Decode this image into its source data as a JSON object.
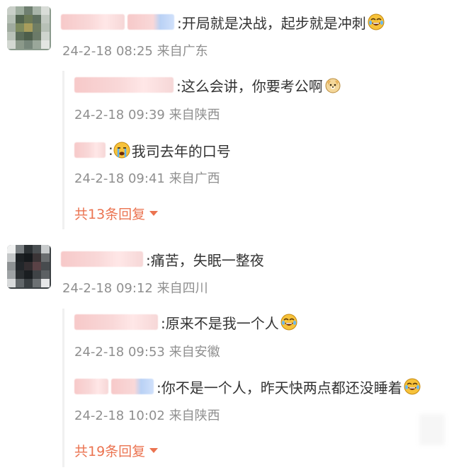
{
  "comments": [
    {
      "text": ":开局就是决战，起步就是冲刺",
      "emoji": "laughing-tears-emoji",
      "meta": "24-2-18 08:25 来自广东",
      "replies": [
        {
          "text": ":这么会讲，你要考公啊",
          "emoji": "doge-emoji",
          "meta": "24-2-18 09:39 来自陕西"
        },
        {
          "text": ":",
          "emoji_before": "crying-emoji",
          "text_after": "我司去年的口号",
          "meta": "24-2-18 09:41 来自广西"
        }
      ],
      "more_label": "共13条回复"
    },
    {
      "text": ":痛苦，失眠一整夜",
      "meta": "24-2-18 09:12 来自四川",
      "replies": [
        {
          "text": ":原来不是我一个人",
          "emoji": "laughing-tears-emoji",
          "meta": "24-2-18 09:53 来自安徽"
        },
        {
          "text": ":你不是一个人，昨天快两点都还没睡着",
          "emoji": "laughing-tears-emoji",
          "meta": "24-2-18 10:02 来自陕西"
        }
      ],
      "more_label": "共19条回复"
    }
  ],
  "colors": {
    "text": "#333333",
    "meta": "#8f8f8f",
    "link": "#eb7350"
  }
}
